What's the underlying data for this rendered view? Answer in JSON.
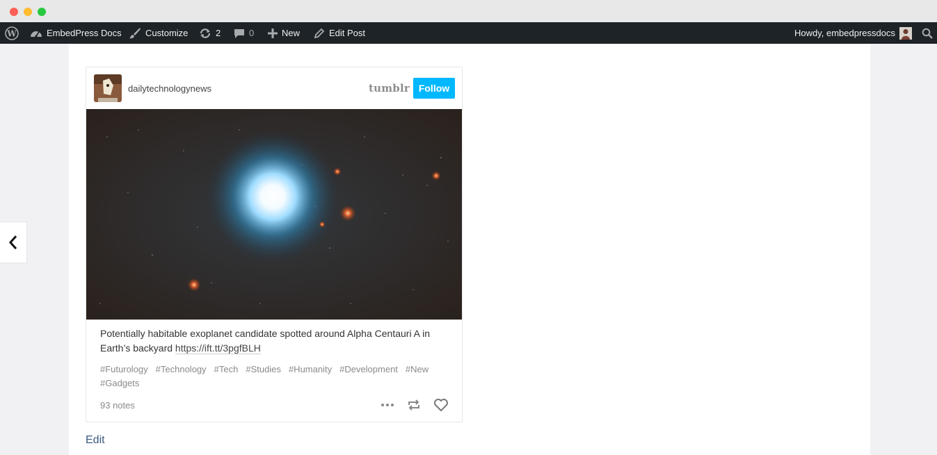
{
  "adminbar": {
    "site_name": "EmbedPress Docs",
    "customize": "Customize",
    "updates_count": "2",
    "comments_count": "0",
    "new_label": "New",
    "edit_post": "Edit Post",
    "howdy": "Howdy, embedpressdocs"
  },
  "post": {
    "blog_name": "dailytechnologynews",
    "platform": "tumblr",
    "follow_label": "Follow",
    "caption": "Potentially habitable exoplanet candidate spotted around Alpha Centauri A in Earth’s backyard",
    "caption_link": "https://ift.tt/3pgfBLH",
    "tags": [
      "#Futurology",
      "#Technology",
      "#Tech",
      "#Studies",
      "#Humanity",
      "#Development",
      "#New",
      "#Gadgets"
    ],
    "notes": "93 notes"
  },
  "edit_label": "Edit",
  "colors": {
    "adminbar_bg": "#1d2327",
    "follow_blue": "#00b8ff",
    "page_bg": "#f1f1f4"
  },
  "icons": {
    "wordpress": "wordpress-logo-icon",
    "dashboard": "dashboard-icon",
    "customize": "paintbrush-icon",
    "updates": "updates-icon",
    "comments": "comment-icon",
    "new": "plus-icon",
    "edit": "pencil-icon",
    "search": "search-icon",
    "prev": "chevron-left-icon",
    "more": "more-dots-icon",
    "reblog": "reblog-icon",
    "like": "heart-icon"
  }
}
